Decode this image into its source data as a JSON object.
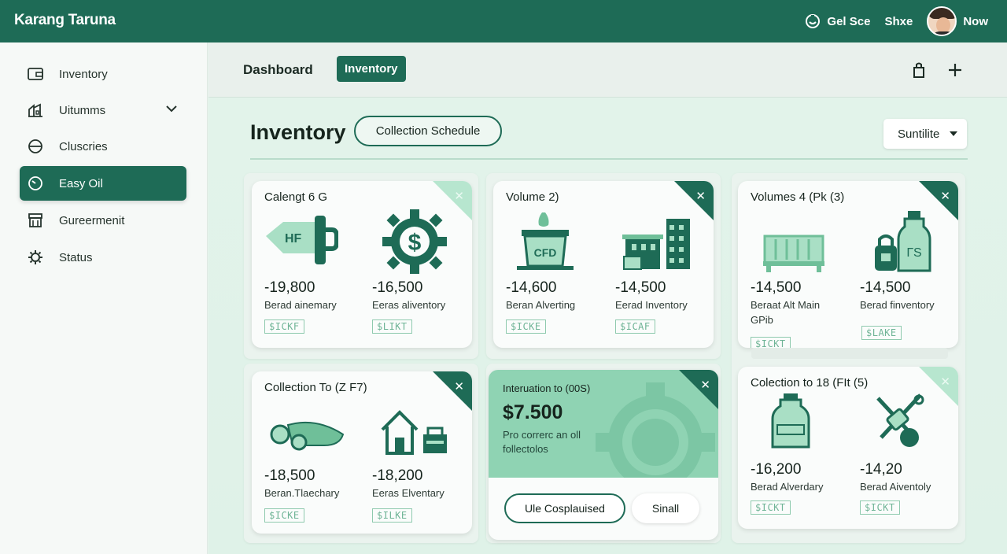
{
  "app": {
    "title": "Karang Taruna"
  },
  "topbar": {
    "link1": "Gel Sce",
    "link2": "Shxe",
    "link3": "Now"
  },
  "sidebar": {
    "items": [
      {
        "label": "Inventory"
      },
      {
        "label": "Uitumms"
      },
      {
        "label": "Cluscries"
      },
      {
        "label": "Easy Oil"
      },
      {
        "label": "Gureermenit"
      },
      {
        "label": "Status"
      }
    ]
  },
  "subbar": {
    "dashboard": "Dashboard",
    "inventory_tab": "Inventory"
  },
  "main": {
    "title": "Inventory",
    "schedule_button": "Collection Schedule",
    "select_value": "Suntilite"
  },
  "cards": [
    {
      "title": "Calengt 6 G",
      "badge": "HF",
      "items": [
        {
          "value": "-19,800",
          "label": "Berad ainemary",
          "tag": "$ICKF"
        },
        {
          "value": "-16,500",
          "label": "Eeras aliventory",
          "tag": "$LIKT"
        }
      ]
    },
    {
      "title": "Volume 2)",
      "badge": "CFD",
      "items": [
        {
          "value": "-14,600",
          "label": "Beran Alverting",
          "tag": "$ICKE"
        },
        {
          "value": "-14,500",
          "label": "Eerad Inventory",
          "tag": "$ICAF"
        }
      ]
    },
    {
      "title": "Volumes 4 (Pk (3)",
      "badge": "ГS",
      "items": [
        {
          "value": "-14,500",
          "label": "Beraat Alt Main GPib",
          "tag": "$ICKT"
        },
        {
          "value": "-14,500",
          "label": "Berad finventory",
          "tag": "$LAKE"
        }
      ]
    },
    {
      "title": "Collection To (Z F7)",
      "items": [
        {
          "value": "-18,500",
          "label": "Beran.Tlaechary",
          "tag": "$ICKE"
        },
        {
          "value": "-18,200",
          "label": "Eeras Elventary",
          "tag": "$ILKE"
        }
      ]
    },
    {
      "title": "Colection to 18 (FIt (5)",
      "items": [
        {
          "value": "-16,200",
          "label": "Berad Alverdary",
          "tag": "$ICKT"
        },
        {
          "value": "-14,20",
          "label": "Berad Aiventoly",
          "tag": "$ICKT"
        }
      ]
    }
  ],
  "hero": {
    "title": "Interuation to (00S)",
    "amount": "$7.500",
    "desc": "Pro correrc an oll follectolos",
    "button1": "Ule Cosplauised",
    "button2": "Sinall"
  },
  "colors": {
    "primary": "#1e6b56",
    "accent_light": "#8fd3b3",
    "tag": "#6fb496"
  }
}
